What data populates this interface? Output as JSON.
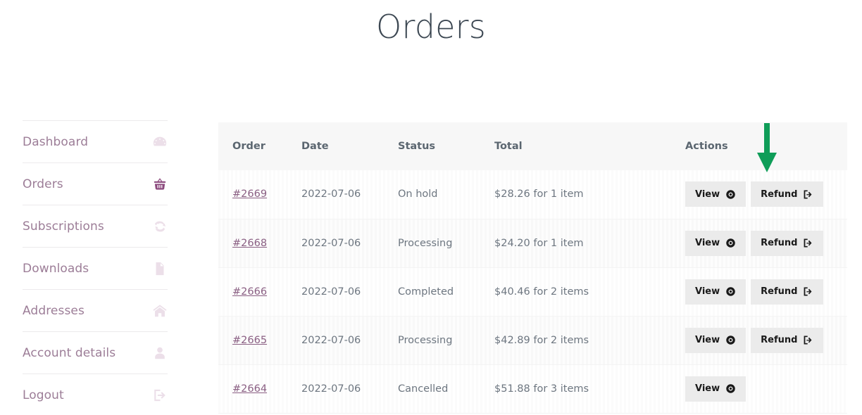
{
  "page": {
    "title": "Orders"
  },
  "sidebar": {
    "items": [
      {
        "label": "Dashboard",
        "icon": "dashboard-icon",
        "active": false
      },
      {
        "label": "Orders",
        "icon": "basket-icon",
        "active": true
      },
      {
        "label": "Subscriptions",
        "icon": "sync-icon",
        "active": false
      },
      {
        "label": "Downloads",
        "icon": "document-icon",
        "active": false
      },
      {
        "label": "Addresses",
        "icon": "home-icon",
        "active": false
      },
      {
        "label": "Account details",
        "icon": "user-icon",
        "active": false
      },
      {
        "label": "Logout",
        "icon": "logout-icon",
        "active": false
      }
    ]
  },
  "orders_table": {
    "columns": [
      "Order",
      "Date",
      "Status",
      "Total",
      "Actions"
    ],
    "rows": [
      {
        "order": "#2669",
        "date": "2022-07-06",
        "status": "On hold",
        "total": "$28.26 for 1 item",
        "actions": [
          {
            "label": "View",
            "icon": "eye-icon"
          },
          {
            "label": "Refund",
            "icon": "sign-out-icon"
          }
        ]
      },
      {
        "order": "#2668",
        "date": "2022-07-06",
        "status": "Processing",
        "total": "$24.20 for 1 item",
        "actions": [
          {
            "label": "View",
            "icon": "eye-icon"
          },
          {
            "label": "Refund",
            "icon": "sign-out-icon"
          }
        ]
      },
      {
        "order": "#2666",
        "date": "2022-07-06",
        "status": "Completed",
        "total": "$40.46 for 2 items",
        "actions": [
          {
            "label": "View",
            "icon": "eye-icon"
          },
          {
            "label": "Refund",
            "icon": "sign-out-icon"
          }
        ]
      },
      {
        "order": "#2665",
        "date": "2022-07-06",
        "status": "Processing",
        "total": "$42.89 for 2 items",
        "actions": [
          {
            "label": "View",
            "icon": "eye-icon"
          },
          {
            "label": "Refund",
            "icon": "sign-out-icon"
          }
        ]
      },
      {
        "order": "#2664",
        "date": "2022-07-06",
        "status": "Cancelled",
        "total": "$51.88 for 3 items",
        "actions": [
          {
            "label": "View",
            "icon": "eye-icon"
          }
        ]
      }
    ]
  },
  "annotation": {
    "arrow": "down-arrow-icon",
    "color": "#0f9d58"
  },
  "colors": {
    "link": "#8a5f83",
    "nav_text": "#9c7d97",
    "nav_icon_inactive": "#ecdfe9",
    "nav_icon_active": "#8c4a7e",
    "header_bg": "#f7f7f7",
    "button_bg": "#ebebeb",
    "title_text": "#3d4853",
    "annotation_green": "#0f9d58"
  }
}
